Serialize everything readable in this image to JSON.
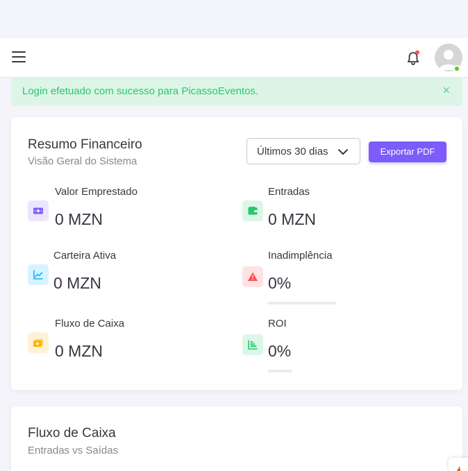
{
  "alert": {
    "message": "Login efetuado com sucesso para PicassoEventos.",
    "close": "×"
  },
  "summary": {
    "title": "Resumo Financeiro",
    "subtitle": "Visão Geral do Sistema",
    "period_select": "Últimos 30 dias",
    "export_label": "Exportar PDF",
    "stats": {
      "loaned": {
        "label": "Valor Emprestado",
        "value": "0 MZN",
        "icon": "money-icon",
        "color": "#7c5cfc"
      },
      "income": {
        "label": "Entradas",
        "value": "0 MZN",
        "icon": "wallet-icon",
        "color": "#28c76f"
      },
      "portfolio": {
        "label": "Carteira Ativa",
        "value": "0 MZN",
        "icon": "chart-line-icon",
        "color": "#16b1ff"
      },
      "default": {
        "label": "Inadimplência",
        "value": "0%",
        "icon": "alert-triangle-icon",
        "color": "#ff4c51",
        "progress": 0
      },
      "cashflow": {
        "label": "Fluxo de Caixa",
        "value": "0 MZN",
        "icon": "cash-icon",
        "color": "#ffb400"
      },
      "roi": {
        "label": "ROI",
        "value": "0%",
        "icon": "bar-chart-icon",
        "color": "#28c76f",
        "progress": 0
      }
    }
  },
  "cashflow_card": {
    "title": "Fluxo de Caixa",
    "subtitle": "Entradas vs Saídas"
  },
  "colors": {
    "accent": "#7c5cfc",
    "success": "#28c76f",
    "danger": "#ff4c51",
    "warning": "#ffb400",
    "info": "#16b1ff"
  }
}
